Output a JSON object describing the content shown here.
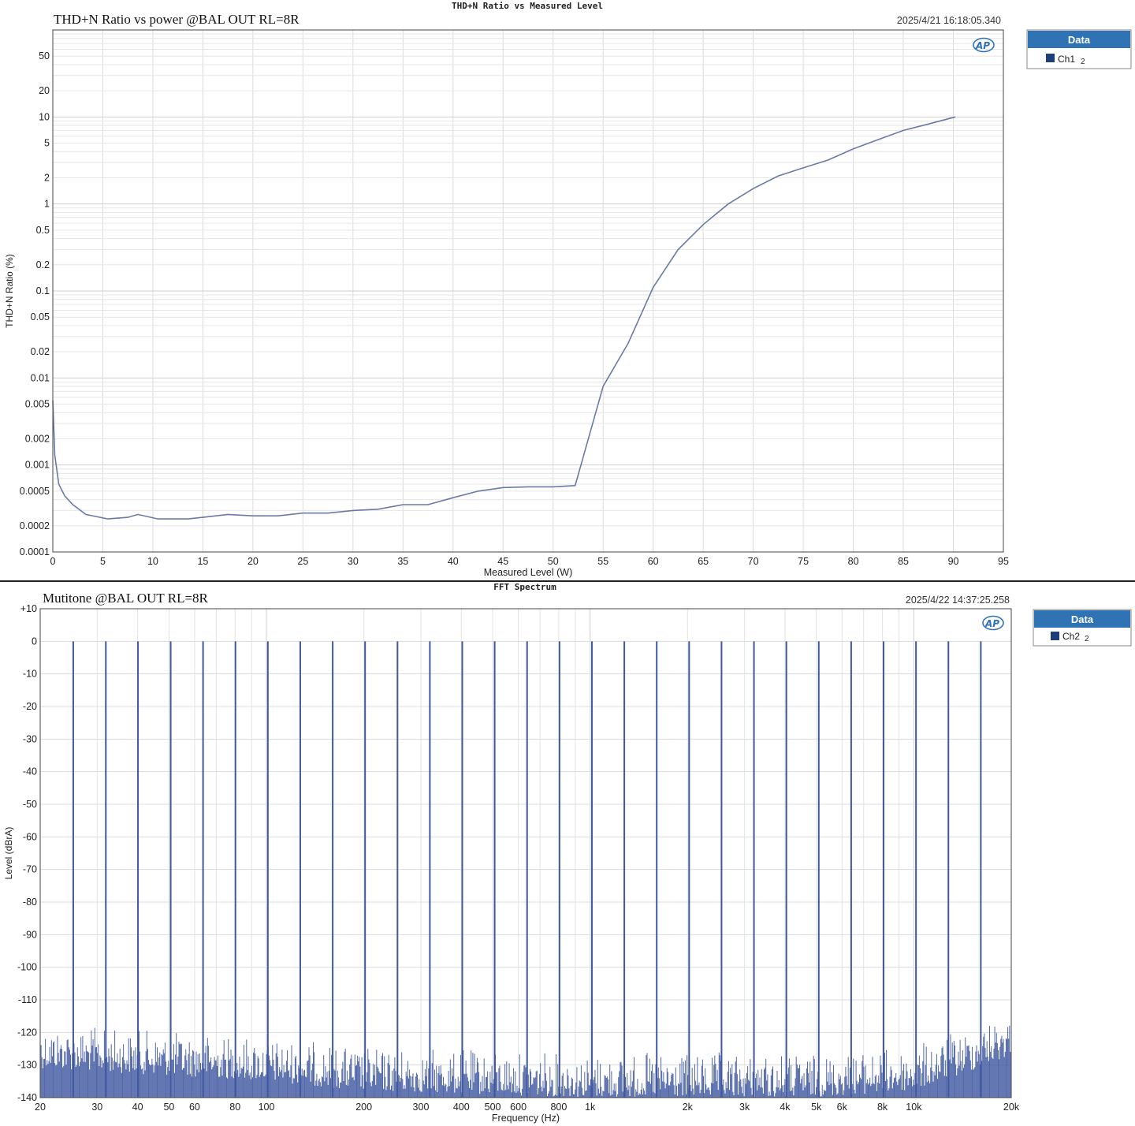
{
  "colors": {
    "line": "#6a7aa8",
    "spectrum": "#3f58a0",
    "legend_header": "#2f73b5",
    "legend_swatch": "#1f3f7a",
    "grid": "#dcdcdc",
    "border": "#333333"
  },
  "chart_data": [
    {
      "type": "line",
      "window_title": "THD+N Ratio vs Measured Level",
      "title": "THD+N Ratio vs power @BAL OUT RL=8R",
      "timestamp": "2025/4/21 16:18:05.340",
      "logo": "AP",
      "xlabel": "Measured Level (W)",
      "ylabel": "THD+N Ratio (%)",
      "xlim": [
        0,
        95
      ],
      "ylim": [
        0.0001,
        100
      ],
      "yscale": "log",
      "grid": true,
      "legend": {
        "header": "Data",
        "placement": "right",
        "items": [
          {
            "name": "Ch1",
            "suffix": "2"
          }
        ]
      },
      "x_ticks": [
        "0",
        "5",
        "10",
        "15",
        "20",
        "25",
        "30",
        "35",
        "40",
        "45",
        "50",
        "55",
        "60",
        "65",
        "70",
        "75",
        "80",
        "85",
        "90",
        "95"
      ],
      "y_ticks": [
        {
          "v": 50,
          "label": "50"
        },
        {
          "v": 20,
          "label": "20"
        },
        {
          "v": 10,
          "label": "10"
        },
        {
          "v": 5,
          "label": "5"
        },
        {
          "v": 2,
          "label": "2"
        },
        {
          "v": 1,
          "label": "1"
        },
        {
          "v": 0.5,
          "label": "0.5"
        },
        {
          "v": 0.2,
          "label": "0.2"
        },
        {
          "v": 0.1,
          "label": "0.1"
        },
        {
          "v": 0.05,
          "label": "0.05"
        },
        {
          "v": 0.02,
          "label": "0.02"
        },
        {
          "v": 0.01,
          "label": "0.01"
        },
        {
          "v": 0.005,
          "label": "0.005"
        },
        {
          "v": 0.002,
          "label": "0.002"
        },
        {
          "v": 0.001,
          "label": "0.001"
        },
        {
          "v": 0.0005,
          "label": "0.0005"
        },
        {
          "v": 0.0002,
          "label": "0.0002"
        },
        {
          "v": 0.0001,
          "label": "0.0001"
        }
      ],
      "series": [
        {
          "name": "Ch1",
          "x": [
            0,
            0.2,
            0.6,
            1.2,
            2,
            3.3,
            5.5,
            7.5,
            8.5,
            10.5,
            13.5,
            15,
            17.5,
            20,
            22.5,
            25,
            27.5,
            30,
            32.5,
            35,
            37.5,
            40,
            42.5,
            45,
            47.5,
            50,
            52.2,
            55,
            57.5,
            60,
            62.5,
            65,
            67.5,
            70,
            72.5,
            75,
            77.5,
            80,
            82.5,
            85,
            87.5,
            90.2
          ],
          "y": [
            0.0055,
            0.0013,
            0.0006,
            0.00044,
            0.00035,
            0.00027,
            0.00024,
            0.00025,
            0.00027,
            0.00024,
            0.00024,
            0.00025,
            0.00027,
            0.00026,
            0.00026,
            0.00028,
            0.00028,
            0.0003,
            0.00031,
            0.00035,
            0.00035,
            0.00042,
            0.0005,
            0.00055,
            0.00056,
            0.00056,
            0.00058,
            0.008,
            0.025,
            0.11,
            0.3,
            0.58,
            1.0,
            1.5,
            2.1,
            2.6,
            3.2,
            4.3,
            5.5,
            7.0,
            8.3,
            10
          ]
        }
      ]
    },
    {
      "type": "line",
      "window_title": "FFT Spectrum",
      "title": "Mutitone @BAL OUT  RL=8R",
      "timestamp": "2025/4/22 14:37:25.258",
      "logo": "AP",
      "xlabel": "Frequency (Hz)",
      "ylabel": "Level (dBrA)",
      "xscale": "log",
      "xlim": [
        20,
        20000
      ],
      "ylim": [
        -140,
        10
      ],
      "grid": true,
      "legend": {
        "header": "Data",
        "placement": "right",
        "items": [
          {
            "name": "Ch2",
            "suffix": "2"
          }
        ]
      },
      "x_ticks": [
        {
          "v": 20,
          "label": "20"
        },
        {
          "v": 30,
          "label": "30"
        },
        {
          "v": 40,
          "label": "40"
        },
        {
          "v": 50,
          "label": "50"
        },
        {
          "v": 60,
          "label": "60"
        },
        {
          "v": 80,
          "label": "80"
        },
        {
          "v": 100,
          "label": "100"
        },
        {
          "v": 200,
          "label": "200"
        },
        {
          "v": 300,
          "label": "300"
        },
        {
          "v": 400,
          "label": "400"
        },
        {
          "v": 500,
          "label": "500"
        },
        {
          "v": 600,
          "label": "600"
        },
        {
          "v": 800,
          "label": "800"
        },
        {
          "v": 1000,
          "label": "1k"
        },
        {
          "v": 2000,
          "label": "2k"
        },
        {
          "v": 3000,
          "label": "3k"
        },
        {
          "v": 4000,
          "label": "4k"
        },
        {
          "v": 5000,
          "label": "5k"
        },
        {
          "v": 6000,
          "label": "6k"
        },
        {
          "v": 8000,
          "label": "8k"
        },
        {
          "v": 10000,
          "label": "10k"
        },
        {
          "v": 20000,
          "label": "20k"
        }
      ],
      "y_ticks": [
        "+10",
        "0",
        "-10",
        "-20",
        "-30",
        "-40",
        "-50",
        "-60",
        "-70",
        "-80",
        "-90",
        "-100",
        "-110",
        "-120",
        "-130",
        "-140"
      ],
      "tones_hz": [
        25.3,
        31.9,
        40.1,
        50.6,
        63.7,
        80.2,
        101,
        127.2,
        160.2,
        201.7,
        254,
        319.8,
        402.7,
        507.1,
        638.6,
        804.2,
        1012.7,
        1275.3,
        1606,
        2022.4,
        2546.8,
        3207.1,
        4038.7,
        5085.9,
        6404.6,
        8065.3,
        10156.6,
        12790,
        16106.3
      ],
      "tone_level_dBrA": 0,
      "noise_floor_dBrA": [
        {
          "f": 20,
          "min": -140,
          "max": -117
        },
        {
          "f": 100,
          "min": -140,
          "max": -121
        },
        {
          "f": 200,
          "min": -140,
          "max": -124
        },
        {
          "f": 1000,
          "min": -140,
          "max": -126
        },
        {
          "f": 5000,
          "min": -140,
          "max": -126
        },
        {
          "f": 10000,
          "min": -140,
          "max": -124
        },
        {
          "f": 15000,
          "min": -140,
          "max": -118
        },
        {
          "f": 20000,
          "min": -140,
          "max": -113
        }
      ]
    }
  ]
}
